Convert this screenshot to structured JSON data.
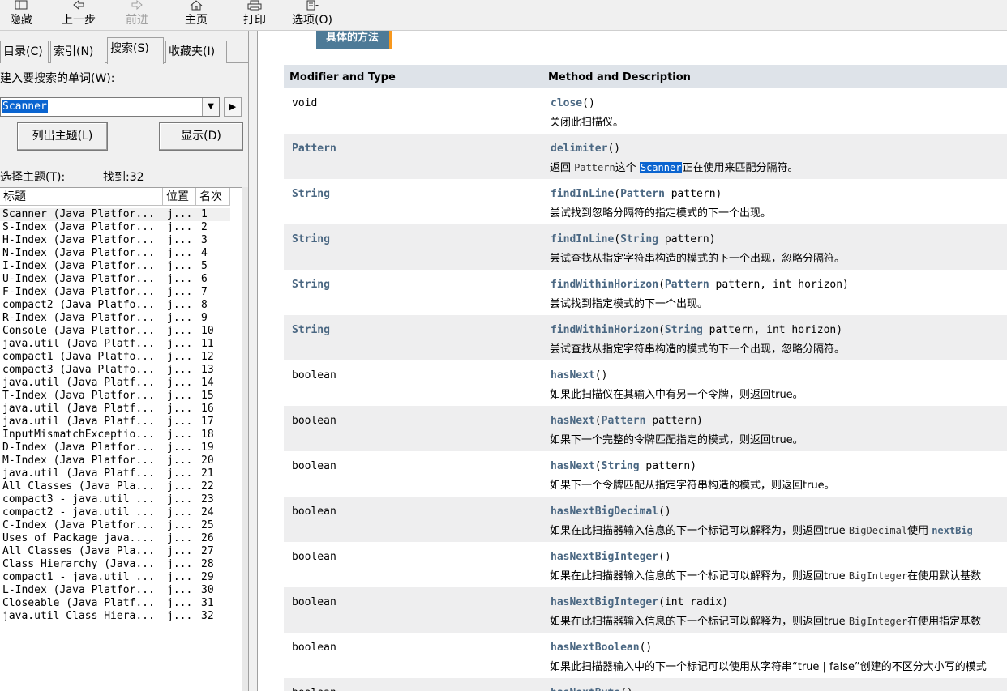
{
  "toolbar": {
    "hide": "隐藏",
    "back": "上一步",
    "forward": "前进",
    "home": "主页",
    "print": "打印",
    "options": "选项(O)"
  },
  "tabs": {
    "contents": "目录(C)",
    "index": "索引(N)",
    "search": "搜索(S)",
    "favorites": "收藏夹(I)"
  },
  "search": {
    "keyword_label": "键入要搜索的单词(W):",
    "keyword_label_visible": "建入要搜索的单词(W):",
    "value": "Scanner",
    "list_topics_button": "列出主题(L)",
    "display_button": "显示(D)",
    "select_topic_label": "选择主题(T):",
    "found_label": "找到:32"
  },
  "results": {
    "columns": [
      "标题",
      "位置",
      "名次"
    ],
    "rows": [
      {
        "title": "Scanner (Java Platfor...",
        "location": "j...",
        "rank": "1"
      },
      {
        "title": "S-Index (Java Platfor...",
        "location": "j...",
        "rank": "2"
      },
      {
        "title": "H-Index (Java Platfor...",
        "location": "j...",
        "rank": "3"
      },
      {
        "title": "N-Index (Java Platfor...",
        "location": "j...",
        "rank": "4"
      },
      {
        "title": "I-Index (Java Platfor...",
        "location": "j...",
        "rank": "5"
      },
      {
        "title": "U-Index (Java Platfor...",
        "location": "j...",
        "rank": "6"
      },
      {
        "title": "F-Index (Java Platfor...",
        "location": "j...",
        "rank": "7"
      },
      {
        "title": "compact2 (Java Platfo...",
        "location": "j...",
        "rank": "8"
      },
      {
        "title": "R-Index (Java Platfor...",
        "location": "j...",
        "rank": "9"
      },
      {
        "title": "Console (Java Platfor...",
        "location": "j...",
        "rank": "10"
      },
      {
        "title": "java.util (Java Platf...",
        "location": "j...",
        "rank": "11"
      },
      {
        "title": "compact1 (Java Platfo...",
        "location": "j...",
        "rank": "12"
      },
      {
        "title": "compact3 (Java Platfo...",
        "location": "j...",
        "rank": "13"
      },
      {
        "title": "java.util (Java Platf...",
        "location": "j...",
        "rank": "14"
      },
      {
        "title": "T-Index (Java Platfor...",
        "location": "j...",
        "rank": "15"
      },
      {
        "title": "java.util (Java Platf...",
        "location": "j...",
        "rank": "16"
      },
      {
        "title": "java.util (Java Platf...",
        "location": "j...",
        "rank": "17"
      },
      {
        "title": "InputMismatchExceptio...",
        "location": "j...",
        "rank": "18"
      },
      {
        "title": "D-Index (Java Platfor...",
        "location": "j...",
        "rank": "19"
      },
      {
        "title": "M-Index (Java Platfor...",
        "location": "j...",
        "rank": "20"
      },
      {
        "title": "java.util (Java Platf...",
        "location": "j...",
        "rank": "21"
      },
      {
        "title": "All Classes (Java Pla...",
        "location": "j...",
        "rank": "22"
      },
      {
        "title": "compact3 - java.util ...",
        "location": "j...",
        "rank": "23"
      },
      {
        "title": "compact2 - java.util ...",
        "location": "j...",
        "rank": "24"
      },
      {
        "title": "C-Index (Java Platfor...",
        "location": "j...",
        "rank": "25"
      },
      {
        "title": "Uses of Package java....",
        "location": "j...",
        "rank": "26"
      },
      {
        "title": "All Classes (Java Pla...",
        "location": "j...",
        "rank": "27"
      },
      {
        "title": "Class Hierarchy (Java...",
        "location": "j...",
        "rank": "28"
      },
      {
        "title": "compact1 - java.util ...",
        "location": "j...",
        "rank": "29"
      },
      {
        "title": "L-Index (Java Platfor...",
        "location": "j...",
        "rank": "30"
      },
      {
        "title": "Closeable (Java Platf...",
        "location": "j...",
        "rank": "31"
      },
      {
        "title": "java.util Class Hiera...",
        "location": "j...",
        "rank": "32"
      }
    ]
  },
  "doc": {
    "section_tab": "具体的方法",
    "header_modifier": "Modifier and Type",
    "header_method": "Method and Description",
    "methods": [
      {
        "type": "void",
        "type_link": false,
        "name": "close",
        "params": "()",
        "desc": "关闭此扫描仪。"
      },
      {
        "type": "Pattern",
        "type_link": true,
        "name": "delimiter",
        "params": "()",
        "desc_parts": [
          "返回 ",
          "Pattern",
          "这个 ",
          "Scanner",
          "正在使用来匹配分隔符。"
        ]
      },
      {
        "type": "String",
        "type_link": true,
        "name": "findInLine",
        "params_pre": "(",
        "param_type": "Pattern",
        "params_post": " pattern)",
        "desc": "尝试找到忽略分隔符的指定模式的下一个出现。"
      },
      {
        "type": "String",
        "type_link": true,
        "name": "findInLine",
        "params_pre": "(",
        "param_type": "String",
        "params_post": " pattern)",
        "desc": "尝试查找从指定字符串构造的模式的下一个出现，忽略分隔符。"
      },
      {
        "type": "String",
        "type_link": true,
        "name": "findWithinHorizon",
        "params_pre": "(",
        "param_type": "Pattern",
        "params_post": " pattern, int horizon)",
        "desc": "尝试找到指定模式的下一个出现。"
      },
      {
        "type": "String",
        "type_link": true,
        "name": "findWithinHorizon",
        "params_pre": "(",
        "param_type": "String",
        "params_post": " pattern, int horizon)",
        "desc": "尝试查找从指定字符串构造的模式的下一个出现，忽略分隔符。"
      },
      {
        "type": "boolean",
        "type_link": false,
        "name": "hasNext",
        "params": "()",
        "desc": "如果此扫描仪在其输入中有另一个令牌，则返回true。"
      },
      {
        "type": "boolean",
        "type_link": false,
        "name": "hasNext",
        "params_pre": "(",
        "param_type": "Pattern",
        "params_post": " pattern)",
        "desc": "如果下一个完整的令牌匹配指定的模式，则返回true。"
      },
      {
        "type": "boolean",
        "type_link": false,
        "name": "hasNext",
        "params_pre": "(",
        "param_type": "String",
        "params_post": " pattern)",
        "desc": "如果下一个令牌匹配从指定字符串构造的模式，则返回true。"
      },
      {
        "type": "boolean",
        "type_link": false,
        "name": "hasNextBigDecimal",
        "params": "()",
        "desc_parts": [
          "如果在此扫描器输入信息的下一个标记可以解释为，则返回true ",
          "BigDecimal",
          "使用 ",
          "nextBig"
        ]
      },
      {
        "type": "boolean",
        "type_link": false,
        "name": "hasNextBigInteger",
        "params": "()",
        "desc_parts": [
          "如果在此扫描器输入信息的下一个标记可以解释为，则返回true ",
          "BigInteger",
          "在使用默认基数"
        ]
      },
      {
        "type": "boolean",
        "type_link": false,
        "name": "hasNextBigInteger",
        "params": "(int radix)",
        "desc_parts": [
          "如果在此扫描器输入信息的下一个标记可以解释为，则返回true ",
          "BigInteger",
          "在使用指定基数"
        ]
      },
      {
        "type": "boolean",
        "type_link": false,
        "name": "hasNextBoolean",
        "params": "()",
        "desc": "如果此扫描器输入中的下一个标记可以使用从字符串“true | false”创建的不区分大小写的模式"
      },
      {
        "type": "boolean",
        "type_link": false,
        "name": "hasNextByte",
        "params": "()",
        "desc": ""
      }
    ]
  }
}
